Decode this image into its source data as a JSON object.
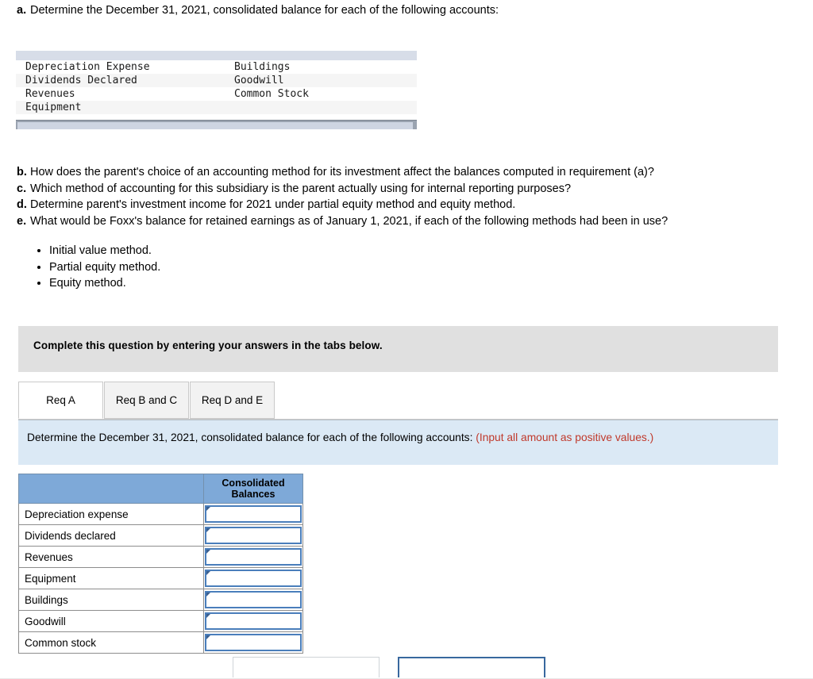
{
  "requirement_a": {
    "letter": "a.",
    "text": "Determine the December 31, 2021, consolidated balance for each of the following accounts:"
  },
  "account_table": {
    "rows": [
      {
        "col1": "Depreciation Expense",
        "col2": "Buildings"
      },
      {
        "col1": "Dividends Declared",
        "col2": "Goodwill"
      },
      {
        "col1": "Revenues",
        "col2": "Common Stock"
      },
      {
        "col1": "Equipment",
        "col2": ""
      }
    ]
  },
  "questions": [
    {
      "letter": "b.",
      "text": "How does the parent's choice of an accounting method for its investment affect the balances computed in requirement (a)?"
    },
    {
      "letter": "c.",
      "text": "Which method of accounting for this subsidiary is the parent actually using for internal reporting purposes?"
    },
    {
      "letter": "d.",
      "text": "Determine parent's investment income for 2021 under partial equity method and equity method."
    },
    {
      "letter": "e.",
      "text": "What would be Foxx's balance for retained earnings as of January 1, 2021, if each of the following methods had been in use?"
    }
  ],
  "bullets": [
    "Initial value method.",
    "Partial equity method.",
    "Equity method."
  ],
  "banner": {
    "text": "Complete this question by entering your answers in the tabs below."
  },
  "tabs": [
    {
      "label": "Req A",
      "active": true
    },
    {
      "label": "Req B and C",
      "active": false
    },
    {
      "label": "Req D and E",
      "active": false
    }
  ],
  "instruction": {
    "main": "Determine the December 31, 2021, consolidated balance for each of the following accounts:",
    "note": "(Input all amount as positive values.)"
  },
  "answer_table": {
    "header_blank": "",
    "header_balances_line1": "Consolidated",
    "header_balances_line2": "Balances",
    "rows": [
      {
        "label": "Depreciation expense",
        "value": ""
      },
      {
        "label": "Dividends declared",
        "value": ""
      },
      {
        "label": "Revenues",
        "value": ""
      },
      {
        "label": "Equipment",
        "value": ""
      },
      {
        "label": "Buildings",
        "value": ""
      },
      {
        "label": "Goodwill",
        "value": ""
      },
      {
        "label": "Common stock",
        "value": ""
      }
    ]
  },
  "colors": {
    "banner_gray": "#e0e0e0",
    "instruction_blue": "#dbe9f5",
    "table_header_blue": "#7ea9d8",
    "input_border_blue": "#4a7ebb",
    "note_red": "#c0392b",
    "account_header_bar": "#d7dde8"
  }
}
